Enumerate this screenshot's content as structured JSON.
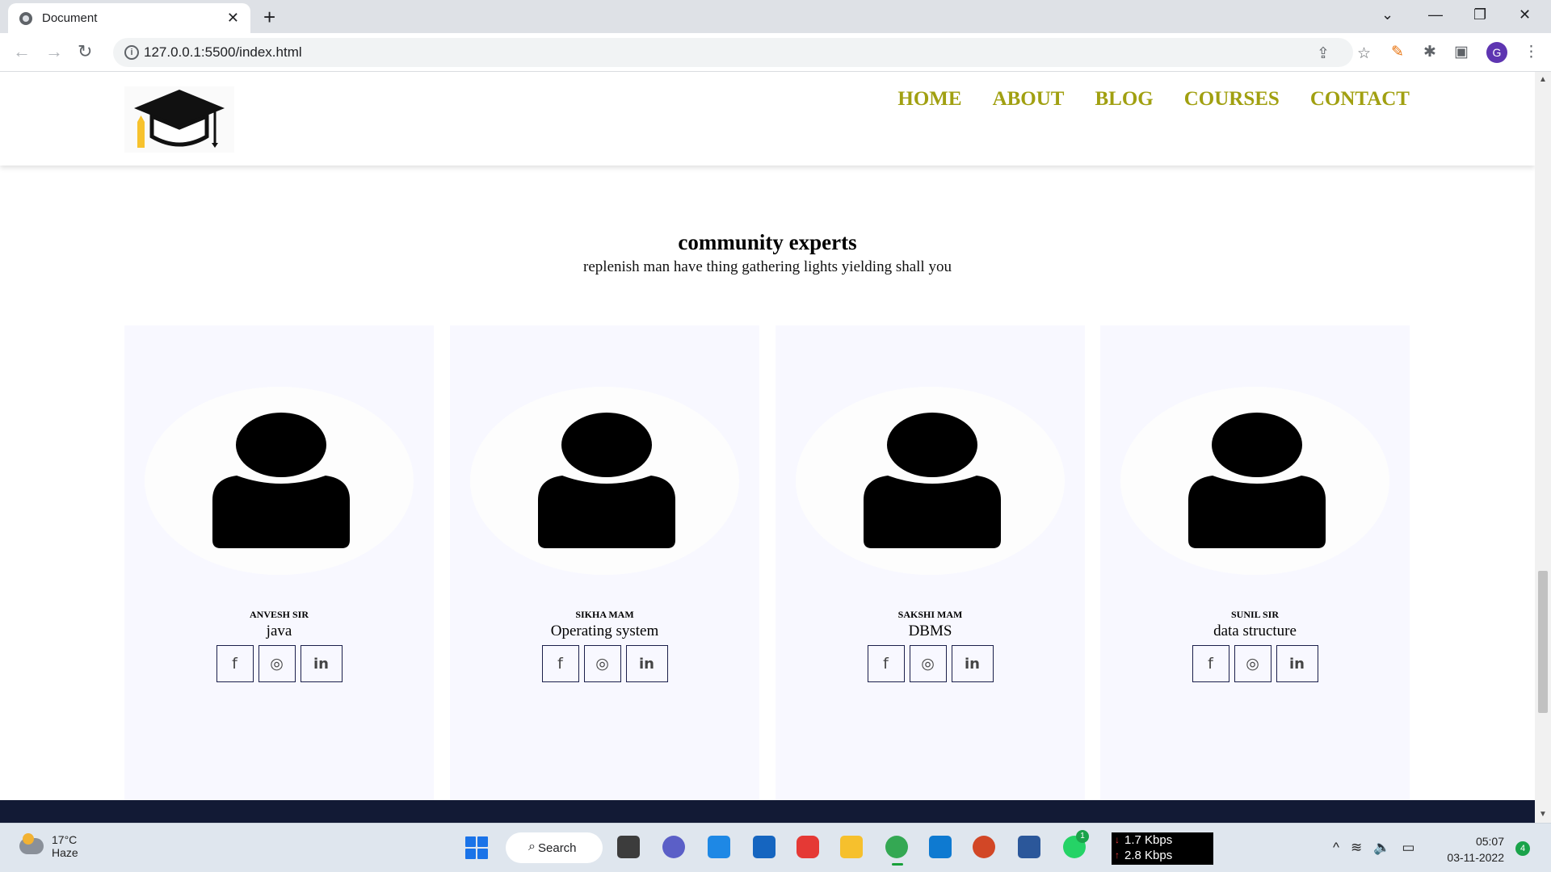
{
  "browser": {
    "tab_title": "Document",
    "url": "127.0.0.1:5500/index.html",
    "profile_initial": "G"
  },
  "site": {
    "nav": [
      "HOME",
      "ABOUT",
      "BLOG",
      "COURSES",
      "CONTACT"
    ],
    "section_title": "community experts",
    "section_subtitle": "replenish man have thing gathering lights yielding shall you",
    "experts": [
      {
        "name": "ANVESH SIR",
        "subject": "java"
      },
      {
        "name": "SIKHA MAM",
        "subject": "Operating system"
      },
      {
        "name": "SAKSHI MAM",
        "subject": "DBMS"
      },
      {
        "name": "SUNIL SIR",
        "subject": "data structure"
      }
    ],
    "social_icons": [
      "facebook-icon",
      "instagram-icon",
      "linkedin-icon"
    ],
    "colors": {
      "nav": "#a1a011",
      "card_bg": "#f8f8ff",
      "footer": "#121a35"
    }
  },
  "taskbar": {
    "weather_temp": "17°C",
    "weather_desc": "Haze",
    "search_label": "Search",
    "net_down": "1.7 Kbps",
    "net_up": "2.8 Kbps",
    "time": "05:07",
    "date": "03-11-2022",
    "notification_count": "4",
    "whatsapp_badge": "1"
  }
}
